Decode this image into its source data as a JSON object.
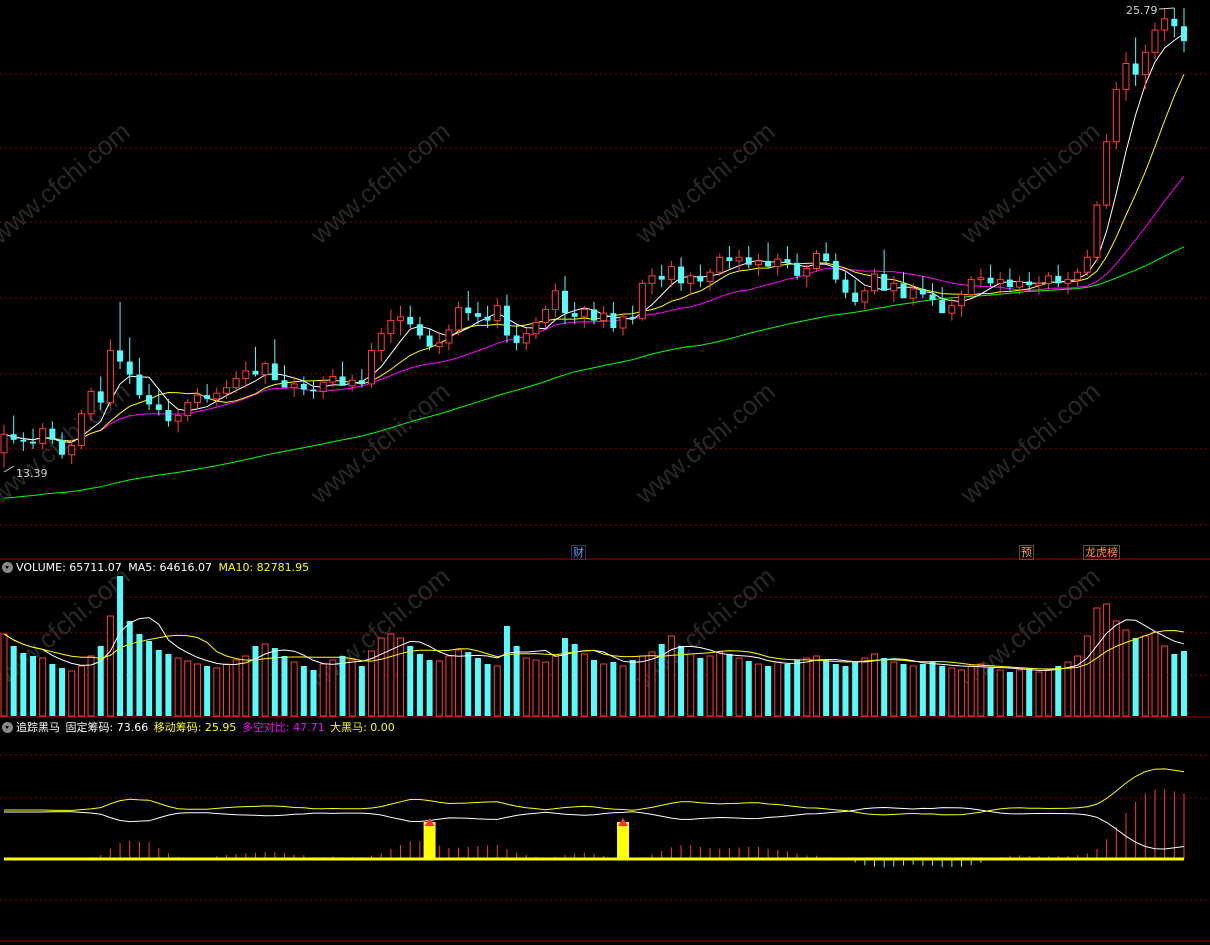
{
  "colors": {
    "bg": "#000000",
    "up": "#ff3b3b",
    "down": "#54fcfc",
    "ma5": "#ffffff",
    "ma10": "#ffff00",
    "ma20": "#ff00ff",
    "ma60": "#00ff00",
    "grid": "#8a0000",
    "volume_label": "#ffffff",
    "ma5_label": "#ffffff",
    "ma10_label": "#ffff00",
    "fixed_label": "#ffffff",
    "moving_label": "#ffff00",
    "ratio_label": "#ff00ff",
    "horse_label": "#ffff00",
    "watermark": "#4a4a4a"
  },
  "price_panel": {
    "high_label": "25.79",
    "low_label": "13.39",
    "watermark": "www.cfchi.com"
  },
  "event_marks": [
    {
      "text": "财",
      "color": "#5aa0ff"
    },
    {
      "text": "预",
      "color": "#ff9a3c"
    },
    {
      "text": "龙虎榜",
      "color": "#ff9a3c"
    }
  ],
  "volume_panel": {
    "label": "VOLUME: 65711.07",
    "ma5": "MA5: 64616.07",
    "ma10": "MA10: 82781.95"
  },
  "indicator_panel": {
    "name": "追踪黑马",
    "fixed": "固定筹码: 73.66",
    "moving": "移动筹码: 25.95",
    "ratio": "多空对比: 47.71",
    "horse": "大黑马: 0.00"
  },
  "chart_data": [
    {
      "type": "candlestick",
      "title": "",
      "ylim": [
        13.0,
        26.2
      ],
      "high_label": 25.79,
      "low_label": 13.39,
      "grid": true,
      "bars": [
        [
          13.85,
          14.6,
          13.45,
          14.35
        ],
        [
          14.35,
          14.85,
          14.1,
          14.2
        ],
        [
          14.2,
          14.4,
          13.9,
          14.15
        ],
        [
          14.15,
          14.5,
          13.95,
          14.1
        ],
        [
          14.1,
          14.65,
          13.95,
          14.5
        ],
        [
          14.5,
          14.7,
          14.1,
          14.2
        ],
        [
          14.2,
          14.4,
          13.7,
          13.8
        ],
        [
          13.8,
          14.2,
          13.55,
          14.05
        ],
        [
          14.05,
          15.0,
          13.95,
          14.9
        ],
        [
          14.9,
          15.6,
          14.7,
          15.5
        ],
        [
          15.5,
          15.9,
          15.0,
          15.2
        ],
        [
          15.2,
          16.9,
          15.1,
          16.6
        ],
        [
          16.6,
          17.9,
          16.1,
          16.3
        ],
        [
          16.3,
          16.95,
          15.7,
          15.95
        ],
        [
          15.95,
          16.4,
          15.3,
          15.4
        ],
        [
          15.4,
          15.7,
          15.0,
          15.15
        ],
        [
          15.15,
          15.6,
          14.85,
          15.0
        ],
        [
          15.0,
          15.3,
          14.55,
          14.7
        ],
        [
          14.7,
          15.0,
          14.4,
          14.85
        ],
        [
          14.85,
          15.3,
          14.7,
          15.2
        ],
        [
          15.2,
          15.6,
          15.0,
          15.4
        ],
        [
          15.4,
          15.7,
          15.2,
          15.3
        ],
        [
          15.3,
          15.6,
          15.1,
          15.45
        ],
        [
          15.45,
          15.8,
          15.3,
          15.6
        ],
        [
          15.6,
          16.05,
          15.45,
          15.85
        ],
        [
          15.85,
          16.3,
          15.6,
          16.05
        ],
        [
          16.05,
          16.7,
          15.9,
          15.95
        ],
        [
          15.95,
          16.3,
          15.7,
          16.25
        ],
        [
          16.25,
          16.9,
          16.05,
          15.8
        ],
        [
          15.8,
          16.2,
          15.6,
          15.6
        ],
        [
          15.6,
          15.9,
          15.35,
          15.7
        ],
        [
          15.7,
          15.9,
          15.4,
          15.55
        ],
        [
          15.55,
          15.8,
          15.3,
          15.5
        ],
        [
          15.5,
          15.9,
          15.3,
          15.75
        ],
        [
          15.75,
          16.1,
          15.6,
          15.9
        ],
        [
          15.9,
          16.3,
          15.7,
          15.65
        ],
        [
          15.65,
          15.95,
          15.5,
          15.8
        ],
        [
          15.8,
          16.1,
          15.6,
          15.7
        ],
        [
          15.7,
          16.8,
          15.6,
          16.6
        ],
        [
          16.6,
          17.2,
          16.3,
          17.05
        ],
        [
          17.05,
          17.7,
          16.8,
          17.4
        ],
        [
          17.4,
          17.8,
          17.0,
          17.5
        ],
        [
          17.5,
          17.8,
          17.2,
          17.3
        ],
        [
          17.3,
          17.5,
          16.9,
          17.0
        ],
        [
          17.0,
          17.2,
          16.6,
          16.7
        ],
        [
          16.7,
          17.1,
          16.5,
          16.8
        ],
        [
          16.8,
          17.3,
          16.6,
          17.15
        ],
        [
          17.15,
          17.9,
          17.0,
          17.75
        ],
        [
          17.75,
          18.2,
          17.4,
          17.6
        ],
        [
          17.6,
          17.9,
          17.3,
          17.5
        ],
        [
          17.5,
          17.8,
          17.2,
          17.4
        ],
        [
          17.4,
          18.0,
          17.2,
          17.8
        ],
        [
          17.8,
          18.1,
          16.8,
          17.0
        ],
        [
          17.0,
          17.3,
          16.6,
          16.8
        ],
        [
          16.8,
          17.2,
          16.6,
          17.05
        ],
        [
          17.05,
          17.5,
          16.9,
          17.35
        ],
        [
          17.35,
          17.8,
          17.2,
          17.7
        ],
        [
          17.7,
          18.4,
          17.5,
          18.2
        ],
        [
          18.2,
          18.6,
          17.3,
          17.6
        ],
        [
          17.6,
          17.9,
          17.3,
          17.5
        ],
        [
          17.5,
          17.8,
          17.2,
          17.7
        ],
        [
          17.7,
          17.9,
          17.3,
          17.4
        ],
        [
          17.4,
          17.8,
          17.2,
          17.6
        ],
        [
          17.6,
          17.9,
          17.1,
          17.2
        ],
        [
          17.2,
          17.6,
          17.0,
          17.5
        ],
        [
          17.5,
          17.8,
          17.3,
          17.45
        ],
        [
          17.45,
          18.5,
          17.4,
          18.4
        ],
        [
          18.4,
          18.8,
          18.1,
          18.6
        ],
        [
          18.6,
          18.9,
          18.3,
          18.5
        ],
        [
          18.5,
          19.0,
          18.3,
          18.85
        ],
        [
          18.85,
          19.1,
          18.2,
          18.4
        ],
        [
          18.4,
          18.7,
          18.1,
          18.6
        ],
        [
          18.6,
          18.9,
          18.3,
          18.45
        ],
        [
          18.45,
          18.8,
          18.2,
          18.7
        ],
        [
          18.7,
          19.2,
          18.6,
          19.1
        ],
        [
          19.1,
          19.4,
          18.8,
          19.0
        ],
        [
          19.0,
          19.3,
          18.7,
          19.1
        ],
        [
          19.1,
          19.4,
          18.8,
          18.9
        ],
        [
          18.9,
          19.2,
          18.6,
          19.0
        ],
        [
          19.0,
          19.5,
          18.8,
          18.85
        ],
        [
          18.85,
          19.2,
          18.6,
          19.05
        ],
        [
          19.05,
          19.4,
          18.8,
          18.95
        ],
        [
          18.95,
          19.2,
          18.5,
          18.6
        ],
        [
          18.6,
          18.9,
          18.3,
          18.8
        ],
        [
          18.8,
          19.3,
          18.7,
          19.2
        ],
        [
          19.2,
          19.5,
          18.9,
          19.0
        ],
        [
          19.0,
          19.2,
          18.4,
          18.5
        ],
        [
          18.5,
          18.7,
          18.0,
          18.15
        ],
        [
          18.15,
          18.5,
          17.8,
          17.9
        ],
        [
          17.9,
          18.3,
          17.7,
          18.2
        ],
        [
          18.2,
          18.8,
          18.1,
          18.65
        ],
        [
          18.65,
          19.3,
          18.5,
          18.2
        ],
        [
          18.2,
          18.6,
          17.9,
          18.4
        ],
        [
          18.4,
          18.7,
          18.1,
          18.0
        ],
        [
          18.0,
          18.4,
          17.8,
          18.25
        ],
        [
          18.25,
          18.6,
          18.0,
          18.1
        ],
        [
          18.1,
          18.4,
          17.8,
          17.95
        ],
        [
          17.95,
          18.3,
          17.7,
          17.6
        ],
        [
          17.6,
          18.0,
          17.4,
          17.8
        ],
        [
          17.8,
          18.2,
          17.5,
          18.1
        ],
        [
          18.1,
          18.6,
          18.0,
          18.5
        ],
        [
          18.5,
          18.8,
          18.3,
          18.55
        ],
        [
          18.55,
          18.9,
          18.3,
          18.4
        ],
        [
          18.4,
          18.7,
          18.1,
          18.5
        ],
        [
          18.5,
          18.8,
          18.2,
          18.3
        ],
        [
          18.3,
          18.6,
          18.1,
          18.45
        ],
        [
          18.45,
          18.7,
          18.2,
          18.35
        ],
        [
          18.35,
          18.6,
          18.1,
          18.4
        ],
        [
          18.4,
          18.7,
          18.2,
          18.6
        ],
        [
          18.6,
          18.9,
          18.3,
          18.4
        ],
        [
          18.4,
          18.7,
          18.1,
          18.5
        ],
        [
          18.5,
          18.8,
          18.3,
          18.7
        ],
        [
          18.7,
          19.3,
          18.6,
          19.1
        ],
        [
          19.1,
          20.6,
          19.0,
          20.5
        ],
        [
          20.5,
          22.4,
          20.4,
          22.2
        ],
        [
          22.2,
          23.8,
          22.0,
          23.6
        ],
        [
          23.6,
          24.6,
          23.3,
          24.3
        ],
        [
          24.3,
          25.0,
          23.7,
          24.0
        ],
        [
          24.0,
          24.8,
          23.6,
          24.6
        ],
        [
          24.6,
          25.4,
          24.4,
          25.2
        ],
        [
          25.2,
          25.79,
          24.9,
          25.5
        ],
        [
          25.5,
          25.79,
          25.0,
          25.3
        ],
        [
          25.3,
          25.79,
          24.6,
          24.9
        ]
      ],
      "ma_series": [
        "MA5",
        "MA10",
        "MA20",
        "MA60"
      ]
    },
    {
      "type": "bar",
      "title": "VOLUME",
      "volume": 65711.07,
      "ma5": 64616.07,
      "ma10": 82781.95,
      "values": [
        82,
        70,
        63,
        60,
        58,
        52,
        48,
        45,
        50,
        60,
        70,
        100,
        140,
        95,
        82,
        75,
        66,
        62,
        58,
        55,
        52,
        50,
        48,
        52,
        56,
        60,
        70,
        72,
        68,
        60,
        54,
        50,
        46,
        52,
        56,
        60,
        56,
        50,
        65,
        78,
        82,
        78,
        70,
        62,
        56,
        55,
        60,
        66,
        64,
        58,
        52,
        50,
        90,
        70,
        58,
        56,
        54,
        60,
        78,
        72,
        62,
        56,
        52,
        54,
        50,
        56,
        60,
        64,
        72,
        80,
        70,
        62,
        58,
        60,
        64,
        62,
        58,
        55,
        52,
        50,
        54,
        52,
        56,
        58,
        60,
        56,
        52,
        50,
        54,
        58,
        62,
        58,
        54,
        52,
        50,
        52,
        54,
        50,
        48,
        46,
        50,
        52,
        48,
        46,
        44,
        46,
        48,
        44,
        46,
        50,
        54,
        60,
        80,
        108,
        112,
        95,
        86,
        78,
        80,
        84,
        70,
        62,
        65
      ]
    },
    {
      "type": "line",
      "title": "追踪黑马",
      "fixed_chips": 73.66,
      "moving_chips": 25.95,
      "long_short_ratio": 47.71,
      "big_dark_horse": 0.0,
      "signals_at_bars": [
        44,
        64
      ]
    }
  ]
}
